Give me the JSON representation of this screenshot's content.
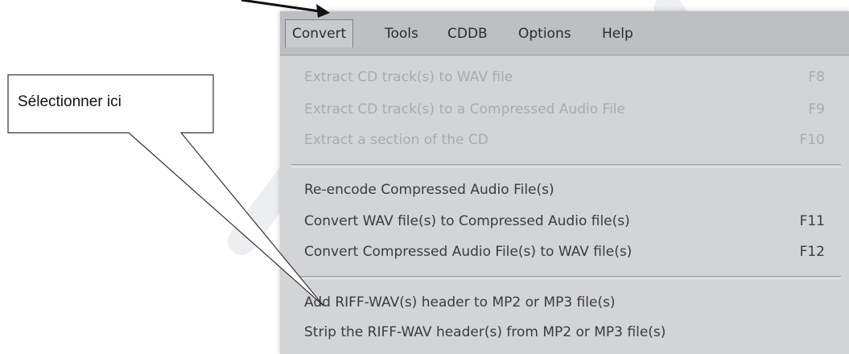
{
  "callout": {
    "text": "Sélectionner ici"
  },
  "menubar": {
    "items": [
      {
        "label": "Convert"
      },
      {
        "label": "Tools"
      },
      {
        "label": "CDDB"
      },
      {
        "label": "Options"
      },
      {
        "label": "Help"
      }
    ]
  },
  "menu": {
    "items": [
      {
        "label": "Extract CD track(s) to WAV file",
        "shortcut": "F8"
      },
      {
        "label": "Extract CD track(s) to a Compressed Audio File",
        "shortcut": "F9"
      },
      {
        "label": "Extract a section of the CD",
        "shortcut": "F10"
      },
      {
        "label": "Re-encode Compressed Audio File(s)",
        "shortcut": ""
      },
      {
        "label": "Convert WAV file(s) to Compressed Audio file(s)",
        "shortcut": "F11"
      },
      {
        "label": "Convert Compressed Audio File(s) to WAV file(s)",
        "shortcut": "F12"
      },
      {
        "label": "Add RIFF-WAV(s) header to MP2 or MP3 file(s)",
        "shortcut": ""
      },
      {
        "label": "Strip the RIFF-WAV header(s) from MP2 or MP3 file(s)",
        "shortcut": ""
      }
    ]
  }
}
